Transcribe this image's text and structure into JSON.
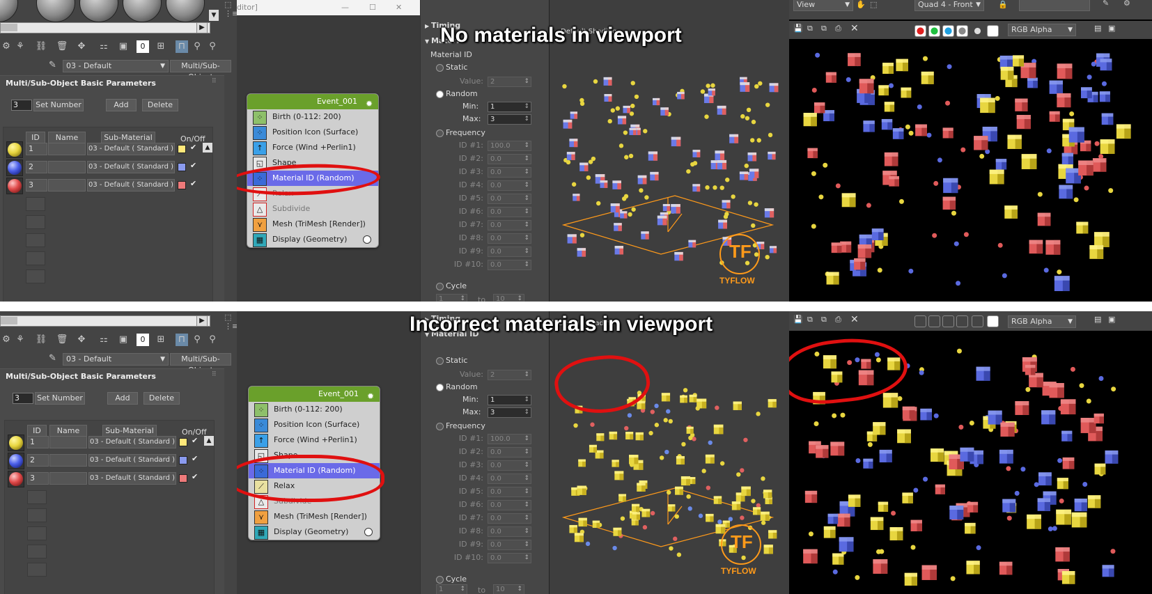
{
  "captions": {
    "top": "No materials in viewport",
    "bottom": "Incorrect materials in viewport"
  },
  "material_editor": {
    "material_dropdown": "03 - Default",
    "material_type": "Multi/Sub-Object",
    "rollout_title": "Multi/Sub-Object Basic Parameters",
    "count_value": "3",
    "set_number": "Set Number",
    "add": "Add",
    "delete": "Delete",
    "headers": {
      "id": "ID",
      "name": "Name",
      "sub_material": "Sub-Material",
      "on_off": "On/Off"
    },
    "rows": [
      {
        "id": "1",
        "sub_material": "03 - Default ( Standard )",
        "ball_color": "#e8d640",
        "swatch": "#ffe87a",
        "checked": "✔"
      },
      {
        "id": "2",
        "sub_material": "03 - Default ( Standard )",
        "ball_color": "#4a5ee8",
        "swatch": "#8a9aee",
        "checked": "✔"
      },
      {
        "id": "3",
        "sub_material": "03 - Default ( Standard )",
        "ball_color": "#e04a4a",
        "swatch": "#ee7a7a",
        "checked": "✔"
      }
    ]
  },
  "node_editor": {
    "window_title_fragment": "ditor]",
    "event_name": "Event_001",
    "operators_top": [
      {
        "label": "Birth (0-112: 200)",
        "icon": "birth-icon",
        "state": "normal"
      },
      {
        "label": "Position Icon (Surface)",
        "icon": "position-icon",
        "state": "normal"
      },
      {
        "label": "Force (Wind +Perlin1)",
        "icon": "force-icon",
        "state": "normal"
      },
      {
        "label": "Shape",
        "icon": "shape-icon",
        "state": "normal"
      },
      {
        "label": "Material ID (Random)",
        "icon": "material-id-icon",
        "state": "selected"
      },
      {
        "label": "Relax",
        "icon": "relax-icon",
        "state": "off"
      },
      {
        "label": "Subdivide",
        "icon": "subdivide-icon",
        "state": "off"
      },
      {
        "label": "Mesh (TriMesh [Render])",
        "icon": "mesh-icon",
        "state": "normal"
      },
      {
        "label": "Display (Geometry)",
        "icon": "display-icon",
        "state": "normal"
      }
    ],
    "operators_bottom": [
      {
        "label": "Birth (0-112: 200)",
        "icon": "birth-icon",
        "state": "normal"
      },
      {
        "label": "Position Icon (Surface)",
        "icon": "position-icon",
        "state": "normal"
      },
      {
        "label": "Force (Wind +Perlin1)",
        "icon": "force-icon",
        "state": "normal"
      },
      {
        "label": "Shape",
        "icon": "shape-icon",
        "state": "normal"
      },
      {
        "label": "Material ID (Random)",
        "icon": "material-id-icon",
        "state": "selected"
      },
      {
        "label": "Relax",
        "icon": "relax-icon",
        "state": "normal"
      },
      {
        "label": "Subdivide",
        "icon": "subdivide-icon",
        "state": "off"
      },
      {
        "label": "Mesh (TriMesh [Render])",
        "icon": "mesh-icon",
        "state": "normal"
      },
      {
        "label": "Display (Geometry)",
        "icon": "display-icon",
        "state": "normal"
      }
    ]
  },
  "params": {
    "timing": "Timing",
    "material_id_section": "Material ID",
    "material_id_tab": "Materi",
    "static": "Static",
    "value_label": "Value:",
    "value": "2",
    "random": "Random",
    "min_label": "Min:",
    "min": "1",
    "max_label": "Max:",
    "max": "3",
    "frequency": "Frequency",
    "freq_ids": [
      {
        "label": "ID #1:",
        "value": "100.0"
      },
      {
        "label": "ID #2:",
        "value": "0.0"
      },
      {
        "label": "ID #3:",
        "value": "0.0"
      },
      {
        "label": "ID #4:",
        "value": "0.0"
      },
      {
        "label": "ID #5:",
        "value": "0.0"
      },
      {
        "label": "ID #6:",
        "value": "0.0"
      },
      {
        "label": "ID #7:",
        "value": "0.0"
      },
      {
        "label": "ID #8:",
        "value": "0.0"
      },
      {
        "label": "ID #9:",
        "value": "0.0"
      },
      {
        "label": "ID #10:",
        "value": "0.0"
      }
    ],
    "cycle": "Cycle",
    "cycle_from": "1",
    "cycle_to_label": "to",
    "cycle_to": "10"
  },
  "viewport": {
    "label_top": "Default Shading",
    "label_bottom": "] [Default Shading ]",
    "logo_text": "TYFLOW",
    "logo_mark": "TF"
  },
  "render_window": {
    "view_dropdown": "View",
    "quad_dropdown": "Quad 4 - Front",
    "channel_dropdown": "RGB Alpha"
  }
}
